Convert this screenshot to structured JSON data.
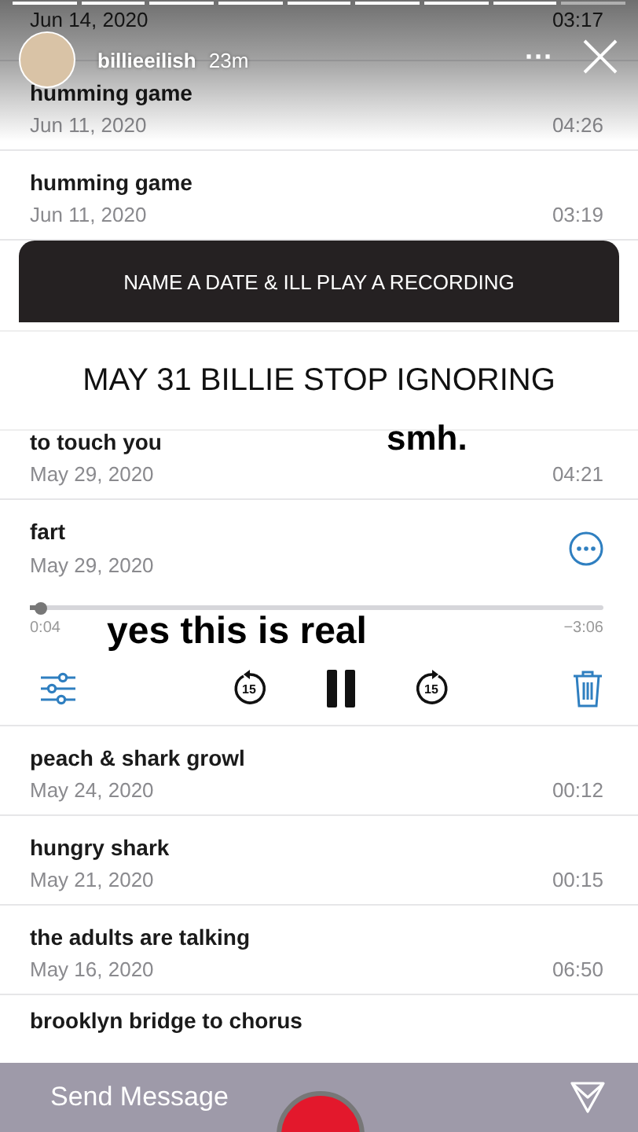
{
  "story": {
    "segments": [
      {
        "level": 1
      },
      {
        "level": 1
      },
      {
        "level": 1
      },
      {
        "level": 1
      },
      {
        "level": 1
      },
      {
        "level": 1
      },
      {
        "level": 1
      },
      {
        "level": 1
      },
      {
        "level": 0
      }
    ],
    "username": "billieeilish",
    "age": "23m",
    "menu": "···"
  },
  "recordings_top": [
    {
      "date": "Jun 14, 2020",
      "duration": "03:17"
    },
    {
      "title": "humming game",
      "date": "Jun 11, 2020",
      "duration": "04:26"
    },
    {
      "title": "humming game",
      "date": "Jun 11, 2020",
      "duration": "03:19"
    }
  ],
  "banner": "NAME A DATE & ILL PLAY A RECORDING",
  "caption": "MAY 31 BILLIE STOP IGNORING",
  "sticker_smh": "smh.",
  "sticker_real": "yes this is real",
  "recording_before": {
    "title": "to touch you",
    "date": "May 29, 2020",
    "duration": "04:21"
  },
  "player": {
    "title": "fart",
    "date": "May 29, 2020",
    "level": 0.02,
    "elapsed": "0:04",
    "remaining": "−3:06",
    "skip_back": "15",
    "skip_forward": "15",
    "playing": true
  },
  "recordings_bottom": [
    {
      "title": "peach & shark growl",
      "date": "May 24, 2020",
      "duration": "00:12"
    },
    {
      "title": "hungry shark",
      "date": "May 21, 2020",
      "duration": "00:15"
    },
    {
      "title": "the adults are talking",
      "date": "May 16, 2020",
      "duration": "06:50"
    },
    {
      "title": "brooklyn bridge to chorus"
    }
  ],
  "reply": {
    "placeholder": "Send Message"
  }
}
